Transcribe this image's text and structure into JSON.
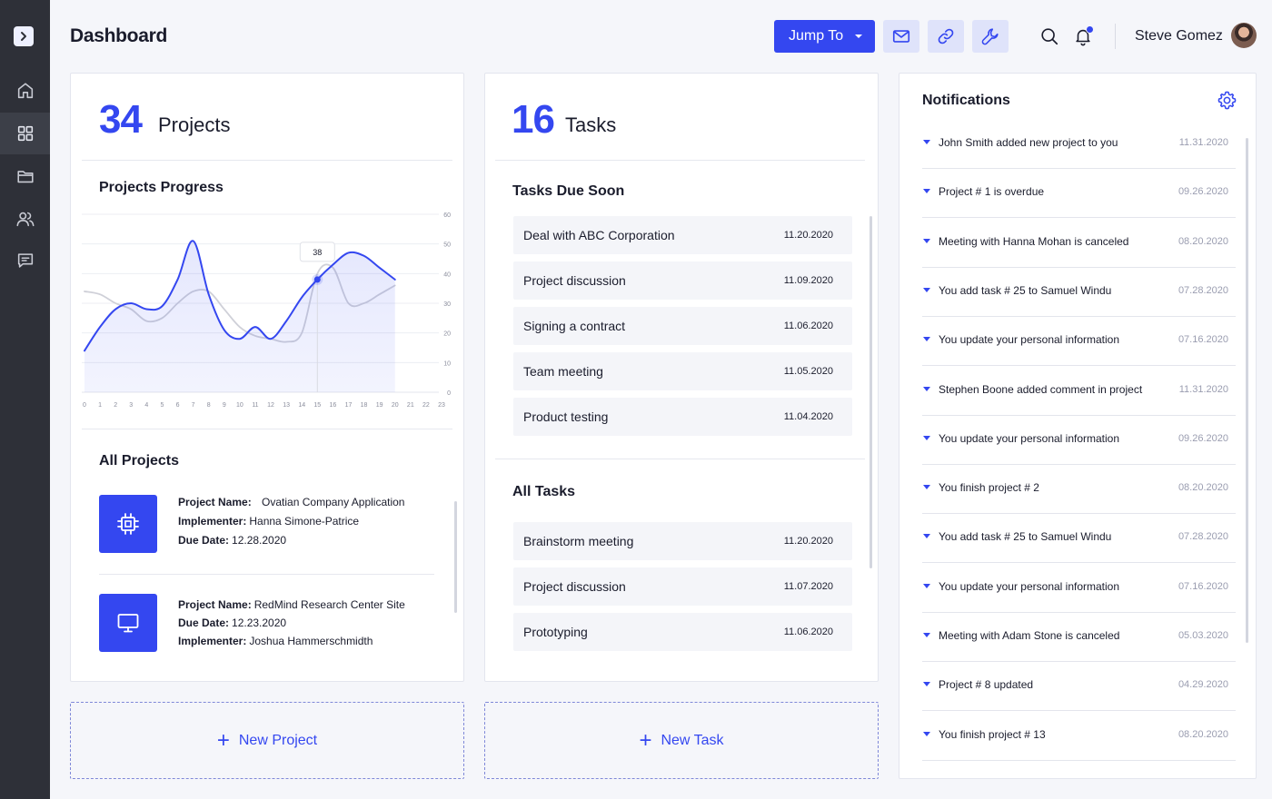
{
  "header": {
    "title": "Dashboard",
    "jump_label": "Jump To",
    "user_name": "Steve Gomez"
  },
  "projects_card": {
    "count": "34",
    "count_label": "Projects",
    "progress_title": "Projects Progress",
    "all_title": "All Projects",
    "items": [
      {
        "icon": "chip-icon",
        "lines": [
          {
            "label": "Project Name:",
            "value": "Ovatian Company Application"
          },
          {
            "label": "Implementer:",
            "value": "Hanna Simone-Patrice"
          },
          {
            "label": "Due Date:",
            "value": "12.28.2020"
          }
        ]
      },
      {
        "icon": "monitor-icon",
        "lines": [
          {
            "label": "Project Name:",
            "value": "RedMind Research Center Site"
          },
          {
            "label": "Due Date:",
            "value": "12.23.2020"
          },
          {
            "label": "Implementer:",
            "value": "Joshua Hammerschmidth"
          }
        ]
      }
    ]
  },
  "chart_data": {
    "type": "line",
    "title": "Projects Progress",
    "x": [
      0,
      1,
      2,
      3,
      4,
      5,
      6,
      7,
      8,
      9,
      10,
      11,
      12,
      13,
      14,
      15,
      16,
      17,
      18,
      19,
      20,
      21,
      22,
      23
    ],
    "xlim": [
      0,
      23
    ],
    "ylim": [
      0,
      60
    ],
    "yticks": [
      0,
      10,
      20,
      30,
      40,
      50,
      60
    ],
    "grid": true,
    "series": [
      {
        "color": "#3447f0",
        "fill": true,
        "x": [
          0,
          1,
          2,
          3,
          4,
          5,
          6,
          7,
          8,
          9,
          10,
          11,
          12,
          13,
          14,
          15,
          16,
          17,
          18,
          19,
          20
        ],
        "values": [
          14,
          22,
          28,
          30,
          28,
          29,
          38,
          51,
          33,
          21,
          18,
          22,
          18,
          24,
          32,
          38,
          43,
          47,
          46,
          42,
          38
        ]
      },
      {
        "color": "#cfd0d8",
        "fill": false,
        "x": [
          0,
          1,
          2,
          3,
          4,
          5,
          6,
          7,
          8,
          9,
          10,
          11,
          12,
          13,
          14,
          15,
          16,
          17,
          18,
          19,
          20
        ],
        "values": [
          34,
          33,
          30,
          28,
          24,
          25,
          30,
          34,
          34,
          28,
          22,
          19,
          18,
          17,
          20,
          40,
          42,
          30,
          30,
          33,
          36
        ]
      }
    ],
    "tooltip": {
      "x": 15,
      "value": 38,
      "label": "38"
    }
  },
  "tasks_card": {
    "count": "16",
    "count_label": "Tasks",
    "due_title": "Tasks Due Soon",
    "due": [
      {
        "name": "Deal with ABC Corporation",
        "date": "11.20.2020"
      },
      {
        "name": "Project discussion",
        "date": "11.09.2020"
      },
      {
        "name": "Signing a contract",
        "date": "11.06.2020"
      },
      {
        "name": "Team meeting",
        "date": "11.05.2020"
      },
      {
        "name": "Product testing",
        "date": "11.04.2020"
      }
    ],
    "all_title": "All Tasks",
    "all": [
      {
        "name": "Brainstorm meeting",
        "date": "11.20.2020"
      },
      {
        "name": "Project discussion",
        "date": "11.07.2020"
      },
      {
        "name": "Prototyping",
        "date": "11.06.2020"
      }
    ]
  },
  "notifications": {
    "title": "Notifications",
    "items": [
      {
        "text": "John Smith added new project to you",
        "date": "11.31.2020"
      },
      {
        "text": "Project # 1 is overdue",
        "date": "09.26.2020"
      },
      {
        "text": "Meeting with Hanna Mohan is canceled",
        "date": "08.20.2020"
      },
      {
        "text": "You add task # 25 to Samuel Windu",
        "date": "07.28.2020"
      },
      {
        "text": "You update your personal information",
        "date": "07.16.2020"
      },
      {
        "text": "Stephen Boone added comment in project",
        "date": "11.31.2020"
      },
      {
        "text": "You update your personal information",
        "date": "09.26.2020"
      },
      {
        "text": "You finish project # 2",
        "date": "08.20.2020"
      },
      {
        "text": "You add task # 25 to Samuel Windu",
        "date": "07.28.2020"
      },
      {
        "text": "You update your personal information",
        "date": "07.16.2020"
      },
      {
        "text": "Meeting with Adam Stone is canceled",
        "date": "05.03.2020"
      },
      {
        "text": "Project # 8 updated",
        "date": "04.29.2020"
      },
      {
        "text": "You finish project # 13",
        "date": "08.20.2020"
      }
    ]
  },
  "actions": {
    "new_project": "New Project",
    "new_task": "New Task",
    "plus": "+"
  },
  "colors": {
    "accent": "#3447f0",
    "sidebar": "#2e3038",
    "background": "#f5f6fa"
  }
}
